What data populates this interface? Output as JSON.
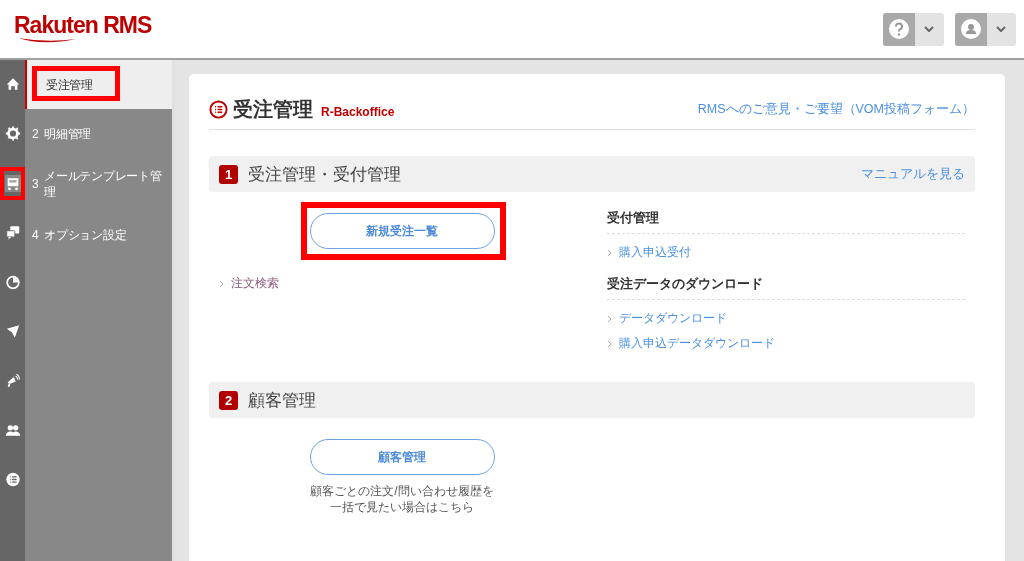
{
  "header": {
    "logo": "Rakuten RMS",
    "menus": [
      {
        "kind": "help"
      },
      {
        "kind": "user"
      }
    ]
  },
  "rail": [
    {
      "highlighted": false
    },
    {
      "highlighted": false
    },
    {
      "highlighted": true
    },
    {
      "highlighted": false
    },
    {
      "highlighted": false
    },
    {
      "highlighted": false
    },
    {
      "highlighted": false
    },
    {
      "highlighted": false
    },
    {
      "highlighted": false
    }
  ],
  "sidebar": [
    {
      "label": "受注管理",
      "selected": true,
      "highlighted": true
    },
    {
      "number": "2",
      "label": "明細管理",
      "selected": false,
      "highlighted": false
    },
    {
      "number": "3",
      "label": "メールテンプレート管理",
      "selected": false,
      "highlighted": false
    },
    {
      "number": "4",
      "label": "オプション設定",
      "selected": false,
      "highlighted": false
    }
  ],
  "page": {
    "title": "受注管理",
    "subtitle": "R-Backoffice",
    "feedback_link": "RMSへのご意見・ご要望（VOM投稿フォーム）"
  },
  "sections": [
    {
      "number": "1",
      "title": "受注管理・受付管理",
      "manual_link": "マニュアルを見る",
      "button": {
        "label": "新規受注一覧",
        "highlighted": true
      },
      "links": [
        {
          "label": "注文検索",
          "visited": true
        }
      ],
      "groups": [
        {
          "heading": "受付管理",
          "links": [
            {
              "label": "購入申込受付",
              "visited": false
            }
          ]
        },
        {
          "heading": "受注データのダウンロード",
          "links": [
            {
              "label": "データダウンロード",
              "visited": false
            },
            {
              "label": "購入申込データダウンロード",
              "visited": false
            }
          ]
        }
      ]
    },
    {
      "number": "2",
      "title": "顧客管理",
      "button": {
        "label": "顧客管理",
        "highlighted": false
      },
      "note_lines": [
        "顧客ごとの注文/問い合わせ履歴を",
        "一括で見たい場合はこちら"
      ]
    }
  ]
}
